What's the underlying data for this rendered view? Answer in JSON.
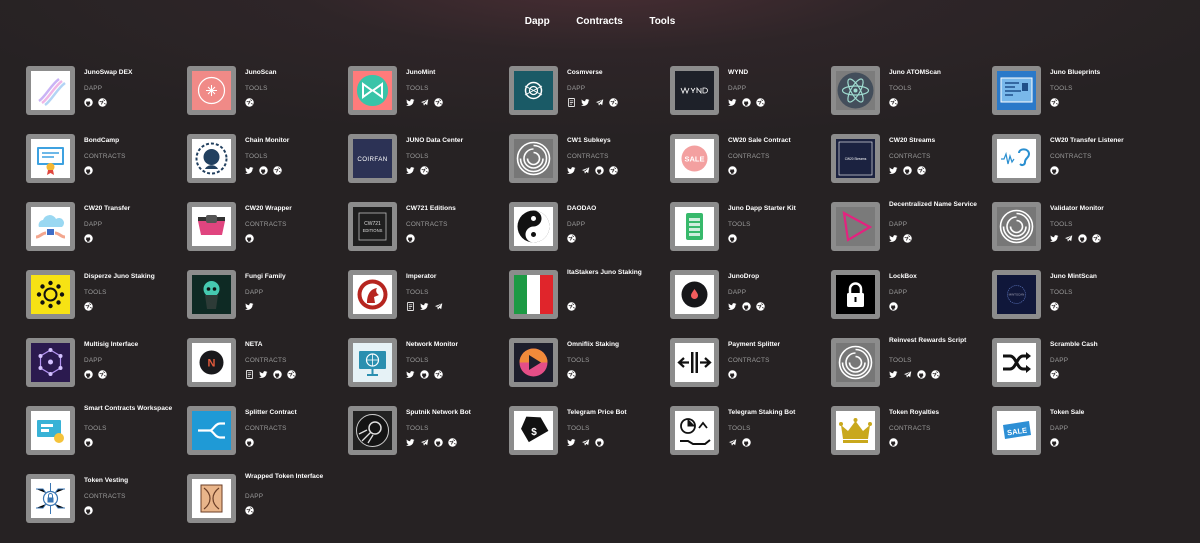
{
  "nav": {
    "dapp": "Dapp",
    "contracts": "Contracts",
    "tools": "Tools"
  },
  "projects": [
    {
      "name": "JunoSwap DEX",
      "category": "DAPP",
      "links": [
        "github",
        "web"
      ],
      "logo": "junoswap"
    },
    {
      "name": "JunoScan",
      "category": "TOOLS",
      "links": [
        "web"
      ],
      "logo": "junoscan"
    },
    {
      "name": "JunoMint",
      "category": "TOOLS",
      "links": [
        "twitter",
        "telegram",
        "web"
      ],
      "logo": "junomint"
    },
    {
      "name": "Cosmverse",
      "category": "DAPP",
      "links": [
        "docs",
        "twitter",
        "telegram",
        "web"
      ],
      "logo": "cosmverse"
    },
    {
      "name": "WYND",
      "category": "DAPP",
      "links": [
        "twitter",
        "github",
        "web"
      ],
      "logo": "wynd"
    },
    {
      "name": "Juno ATOMScan",
      "category": "TOOLS",
      "links": [
        "web"
      ],
      "logo": "atom"
    },
    {
      "name": "Juno Blueprints",
      "category": "TOOLS",
      "links": [
        "web"
      ],
      "logo": "blueprint"
    },
    {
      "name": "BondCamp",
      "category": "CONTRACTS",
      "links": [
        "github"
      ],
      "logo": "bondcamp"
    },
    {
      "name": "Chain Monitor",
      "category": "TOOLS",
      "links": [
        "twitter",
        "github",
        "web"
      ],
      "logo": "chainmonitor"
    },
    {
      "name": "JUNO Data Center",
      "category": "TOOLS",
      "links": [
        "twitter",
        "web"
      ],
      "logo": "coirfan"
    },
    {
      "name": "CW1 Subkeys",
      "category": "CONTRACTS",
      "links": [
        "twitter",
        "telegram",
        "github",
        "web"
      ],
      "logo": "maze"
    },
    {
      "name": "CW20 Sale Contract",
      "category": "CONTRACTS",
      "links": [
        "github"
      ],
      "logo": "sale"
    },
    {
      "name": "CW20 Streams",
      "category": "CONTRACTS",
      "links": [
        "twitter",
        "github",
        "web"
      ],
      "logo": "streams"
    },
    {
      "name": "CW20 Transfer Listener",
      "category": "CONTRACTS",
      "links": [
        "github"
      ],
      "logo": "ear"
    },
    {
      "name": "CW20 Transfer",
      "category": "DAPP",
      "links": [
        "github"
      ],
      "logo": "cloud"
    },
    {
      "name": "CW20 Wrapper",
      "category": "CONTRACTS",
      "links": [
        "github"
      ],
      "logo": "wrapper"
    },
    {
      "name": "CW721 Editions",
      "category": "CONTRACTS",
      "links": [
        "github"
      ],
      "logo": "editions"
    },
    {
      "name": "DAODAO",
      "category": "DAPP",
      "links": [
        "web"
      ],
      "logo": "yinyang"
    },
    {
      "name": "Juno Dapp Starter Kit",
      "category": "TOOLS",
      "links": [
        "github"
      ],
      "logo": "starter"
    },
    {
      "name": "Decentralized Name Service",
      "category": "DAPP",
      "links": [
        "twitter",
        "web"
      ],
      "logo": "triangle"
    },
    {
      "name": "Validator Monitor",
      "category": "TOOLS",
      "links": [
        "twitter",
        "telegram",
        "github",
        "web"
      ],
      "logo": "maze"
    },
    {
      "name": "Disperze Juno Staking",
      "category": "TOOLS",
      "links": [
        "web"
      ],
      "logo": "disperze"
    },
    {
      "name": "Fungi Family",
      "category": "DAPP",
      "links": [
        "twitter"
      ],
      "logo": "fungi"
    },
    {
      "name": "Imperator",
      "category": "TOOLS",
      "links": [
        "docs",
        "twitter",
        "telegram"
      ],
      "logo": "imperator"
    },
    {
      "name": "ItaStakers Juno Staking",
      "category": "",
      "links": [
        "web"
      ],
      "logo": "italy"
    },
    {
      "name": "JunoDrop",
      "category": "DAPP",
      "links": [
        "twitter",
        "github",
        "web"
      ],
      "logo": "junodrop"
    },
    {
      "name": "LockBox",
      "category": "DAPP",
      "links": [
        "github"
      ],
      "logo": "lock"
    },
    {
      "name": "Juno MintScan",
      "category": "TOOLS",
      "links": [
        "web"
      ],
      "logo": "mintscan"
    },
    {
      "name": "Multisig Interface",
      "category": "DAPP",
      "links": [
        "github",
        "web"
      ],
      "logo": "multisig"
    },
    {
      "name": "NETA",
      "category": "CONTRACTS",
      "links": [
        "docs",
        "twitter",
        "github",
        "web"
      ],
      "logo": "neta"
    },
    {
      "name": "Network Monitor",
      "category": "TOOLS",
      "links": [
        "twitter",
        "github",
        "web"
      ],
      "logo": "netmon"
    },
    {
      "name": "Omniflix Staking",
      "category": "TOOLS",
      "links": [
        "web"
      ],
      "logo": "omniflix"
    },
    {
      "name": "Payment Splitter",
      "category": "CONTRACTS",
      "links": [
        "github"
      ],
      "logo": "paysplit"
    },
    {
      "name": "Reinvest Rewards Script",
      "category": "TOOLS",
      "links": [
        "twitter",
        "telegram",
        "github",
        "web"
      ],
      "logo": "maze"
    },
    {
      "name": "Scramble Cash",
      "category": "DAPP",
      "links": [
        "web"
      ],
      "logo": "shuffle"
    },
    {
      "name": "Smart Contracts Workspace",
      "category": "TOOLS",
      "links": [
        "github"
      ],
      "logo": "workspace"
    },
    {
      "name": "Splitter Contract",
      "category": "CONTRACTS",
      "links": [
        "github"
      ],
      "logo": "splitter"
    },
    {
      "name": "Sputnik Network Bot",
      "category": "TOOLS",
      "links": [
        "twitter",
        "telegram",
        "github",
        "web"
      ],
      "logo": "sputnik"
    },
    {
      "name": "Telegram Price Bot",
      "category": "TOOLS",
      "links": [
        "twitter",
        "telegram",
        "github"
      ],
      "logo": "pricetag"
    },
    {
      "name": "Telegram Staking Bot",
      "category": "TOOLS",
      "links": [
        "telegram",
        "github"
      ],
      "logo": "stakingbot"
    },
    {
      "name": "Token Royalties",
      "category": "CONTRACTS",
      "links": [
        "github"
      ],
      "logo": "crown"
    },
    {
      "name": "Token Sale",
      "category": "DAPP",
      "links": [
        "github"
      ],
      "logo": "tokensale"
    },
    {
      "name": "Token Vesting",
      "category": "CONTRACTS",
      "links": [
        "github"
      ],
      "logo": "vesting"
    },
    {
      "name": "Wrapped Token Interface",
      "category": "DAPP",
      "links": [
        "web"
      ],
      "logo": "wrapped"
    }
  ]
}
